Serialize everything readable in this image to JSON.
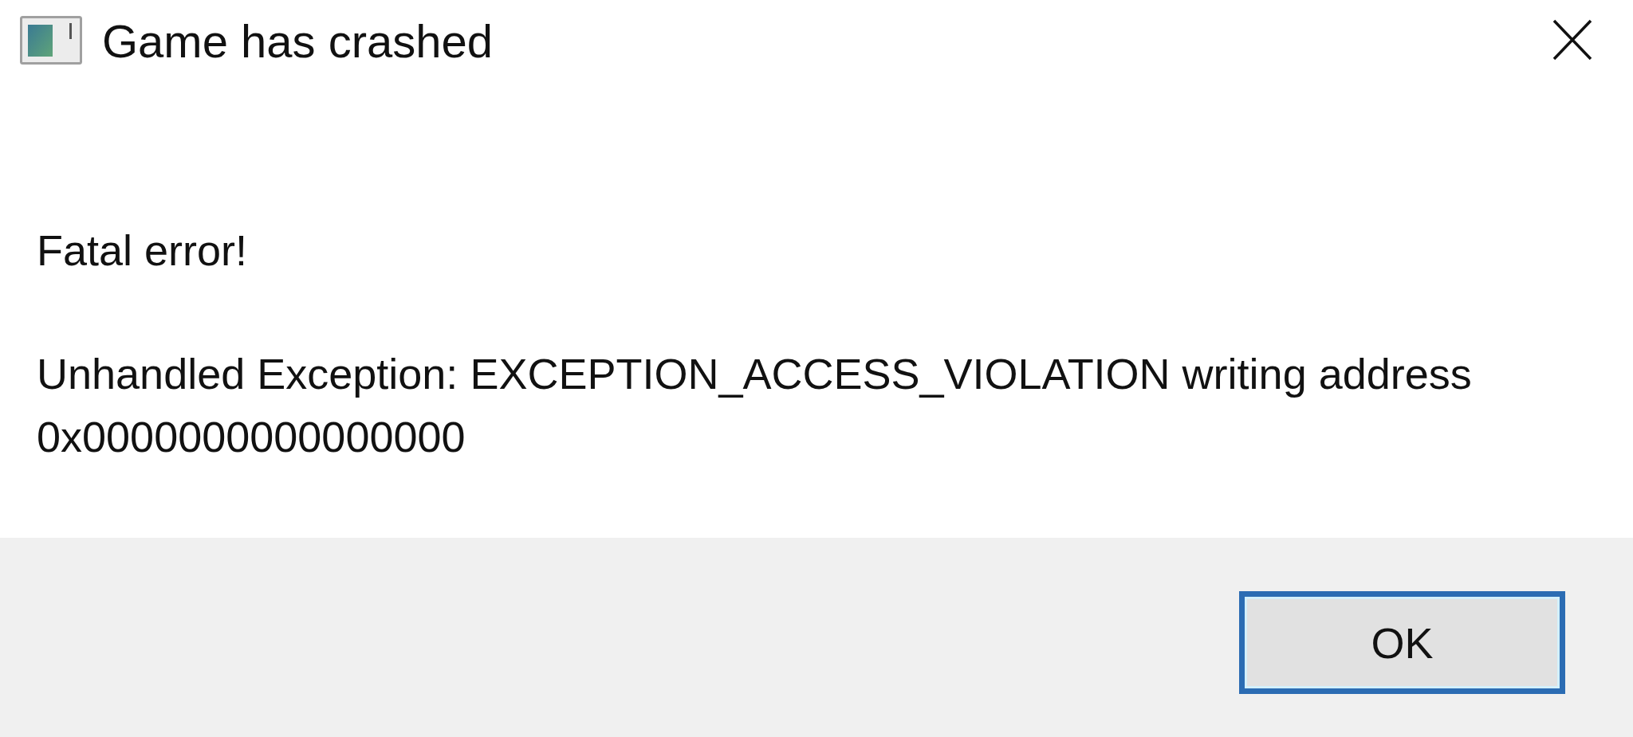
{
  "window": {
    "title": "Game has crashed"
  },
  "message": {
    "heading": "Fatal error!",
    "details": "Unhandled Exception: EXCEPTION_ACCESS_VIOLATION writing address 0x0000000000000000"
  },
  "buttons": [
    {
      "label": "OK",
      "focused": true
    }
  ]
}
